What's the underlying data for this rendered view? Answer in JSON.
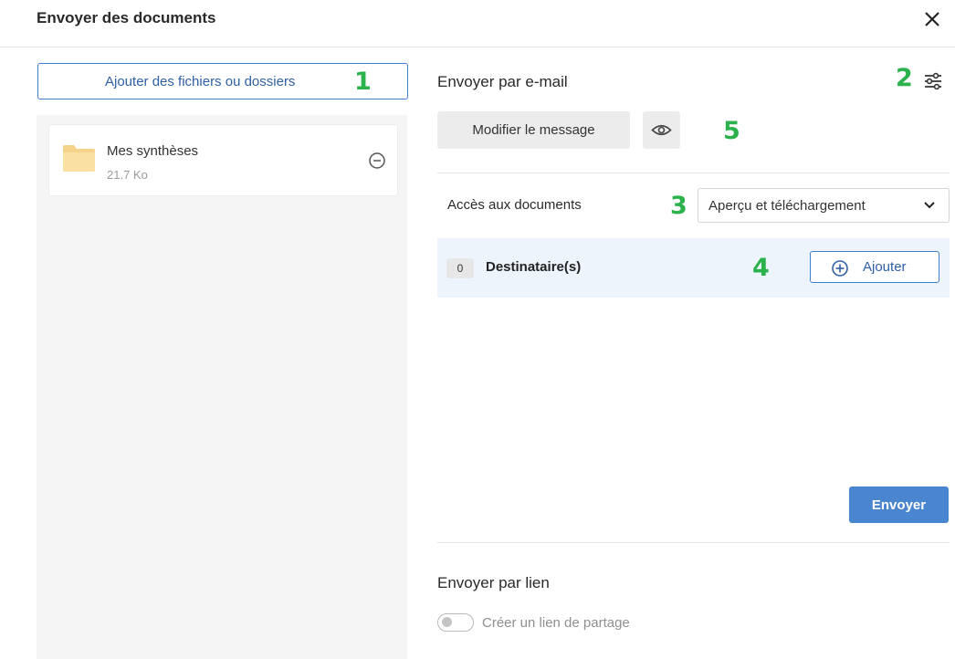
{
  "dialog": {
    "title": "Envoyer des documents"
  },
  "left": {
    "add_button_label": "Ajouter des fichiers ou dossiers",
    "files": [
      {
        "name": "Mes synthèses",
        "size": "21.7 Ko"
      }
    ]
  },
  "email": {
    "section_title": "Envoyer par e-mail",
    "modify_message_label": "Modifier le message",
    "access_label": "Accès aux documents",
    "access_selected": "Aperçu et téléchargement",
    "recipients_count": "0",
    "recipients_label": "Destinataire(s)",
    "add_label": "Ajouter",
    "send_label": "Envoyer"
  },
  "link": {
    "section_title": "Envoyer par lien",
    "toggle_label": "Créer un lien de partage"
  },
  "annotations": {
    "n1": "1",
    "n2": "2",
    "n3": "3",
    "n4": "4",
    "n5": "5"
  },
  "colors": {
    "accent": "#3f7fd0",
    "send_button": "#4a86cf",
    "annotation_green": "#2bb24c",
    "recipients_bg": "#eef4fc",
    "folder": "#f6d38b"
  },
  "icons": [
    "close-icon",
    "folder-icon",
    "minus-circle-icon",
    "settings-sliders-icon",
    "eye-icon",
    "chevron-down-icon",
    "plus-circle-icon"
  ]
}
